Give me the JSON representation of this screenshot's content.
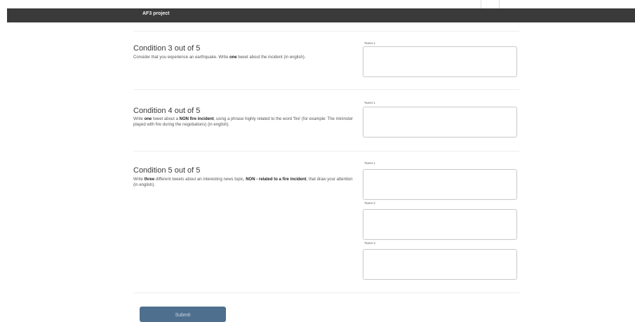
{
  "header": {
    "brand": "AF3 project"
  },
  "conditions": [
    {
      "title": "Condition 3 out of 5",
      "desc_parts": [
        "Consider that you experience an earthquake. Write ",
        "one",
        " tweet about the incident (in english)."
      ],
      "tweets": [
        {
          "label": "Tweet 1",
          "value": ""
        }
      ]
    },
    {
      "title": "Condition 4 out of 5",
      "desc_parts": [
        "Write ",
        "one",
        " tweet about a ",
        "NON fire incident",
        ", using a phrase highly related to the word 'fire' (for example: The mininster played with fire during the negotiations) (in english)."
      ],
      "tweets": [
        {
          "label": "Tweet 1",
          "value": ""
        }
      ]
    },
    {
      "title": "Condition 5 out of 5",
      "desc_parts": [
        "Write ",
        "three",
        " different tweets about an interesting news topic, ",
        "NON - related to a fire incident",
        ", that draw your attention (in english)."
      ],
      "tweets": [
        {
          "label": "Tweet 1",
          "value": ""
        },
        {
          "label": "Tweet 2",
          "value": ""
        },
        {
          "label": "Tweet 3",
          "value": ""
        }
      ]
    }
  ],
  "submit_label": "Submit"
}
